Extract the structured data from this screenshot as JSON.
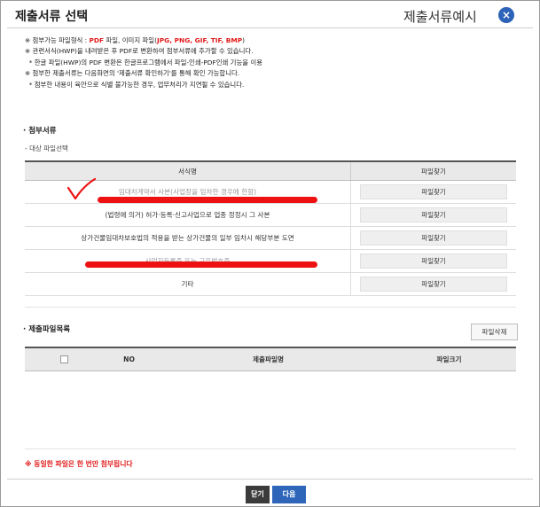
{
  "header": {
    "title": "제출서류 선택",
    "title_right": "제출서류예시",
    "close_glyph": "×"
  },
  "notes": {
    "line1_prefix": "※ 첨부가능 파일형식 : ",
    "line1_pdf": "PDF",
    "line1_mid": " 파일, 이미지 파일(",
    "line1_img": "JPG, PNG, GIF, TIF, BMP",
    "line1_suffix": ")",
    "line2": "※ 관련서식(HWP)을 내려받은 후 PDF로 변환하여 첨부서류에 추가할 수 있습니다.",
    "line3": "  * 한글 파일(HWP)의 PDF 변환은 한글프로그램에서 파일-인쇄-PDF인쇄 기능을 이용",
    "line4": "※ 첨부한 제출서류는 다음화면의 '제출서류 확인하기'를 통해 확인 가능합니다.",
    "line5": "  * 첨부한 내용이 육안으로 식별 불가능한 경우, 업무처리가 지연될 수 있습니다."
  },
  "attach_section": {
    "title": "· 첨부서류",
    "subtitle": "- 대상 파일선택",
    "columns": {
      "name": "서식명",
      "find": "파일찾기"
    },
    "rows": [
      {
        "name": "임대차계약서 사본(사업장을 임차한 경우에 한함)",
        "button": "파일찾기"
      },
      {
        "name": "(법령에 의거) 허가·등록·신고사업으로 업종 정정시 그 사본",
        "button": "파일찾기"
      },
      {
        "name": "상가건물임대차보호법의 적용을 받는 상가건물의 일부 임차시 해당부분 도면",
        "button": "파일찾기"
      },
      {
        "name": "사업자등록증 또는 고유번호증",
        "button": "파일찾기"
      },
      {
        "name": "기타",
        "button": "파일찾기"
      }
    ]
  },
  "submit_section": {
    "title": "· 제출파일목록",
    "delete_button": "파일삭제",
    "columns": {
      "no": "NO",
      "filename": "제출파일명",
      "size": "파일크기"
    }
  },
  "warning": "※ 동일한 파일은 한 번만 첨부됩니다",
  "footer": {
    "close_button": "닫기",
    "next_button": "다음"
  },
  "colors": {
    "accent_blue": "#2f66ba",
    "warning_red": "#e21a1a",
    "dark_button": "#3b3b3b",
    "annotation_red": "#ee1111"
  }
}
